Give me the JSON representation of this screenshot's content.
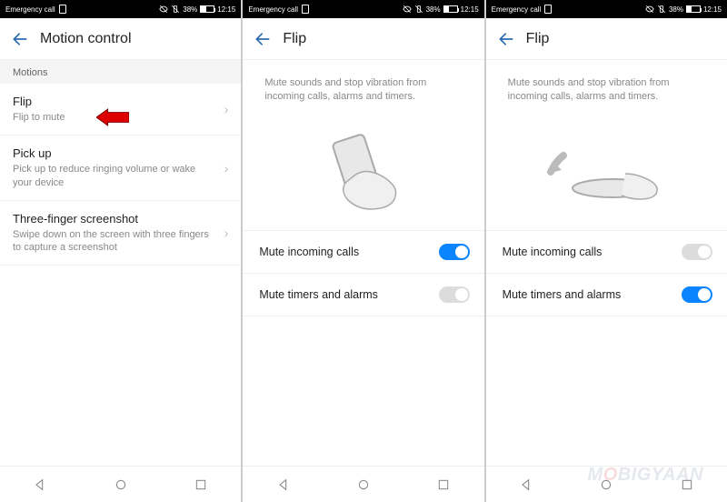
{
  "statusbar": {
    "left_label": "Emergency call",
    "battery_pct": "38%",
    "time": "12:15"
  },
  "screen1": {
    "title": "Motion control",
    "section": "Motions",
    "items": [
      {
        "title": "Flip",
        "sub": "Flip to mute"
      },
      {
        "title": "Pick up",
        "sub": "Pick up to reduce ringing volume or wake your device"
      },
      {
        "title": "Three-finger screenshot",
        "sub": "Swipe down on the screen with three fingers to capture a screenshot"
      }
    ]
  },
  "screen2": {
    "title": "Flip",
    "desc": "Mute sounds and stop vibration from incoming calls, alarms and timers.",
    "toggles": [
      {
        "label": "Mute incoming calls",
        "on": true
      },
      {
        "label": "Mute timers and alarms",
        "on": false
      }
    ]
  },
  "screen3": {
    "title": "Flip",
    "desc": "Mute sounds and stop vibration from incoming calls, alarms and timers.",
    "toggles": [
      {
        "label": "Mute incoming calls",
        "on": false
      },
      {
        "label": "Mute timers and alarms",
        "on": true
      }
    ]
  },
  "watermark": "MOBIGYAAN"
}
